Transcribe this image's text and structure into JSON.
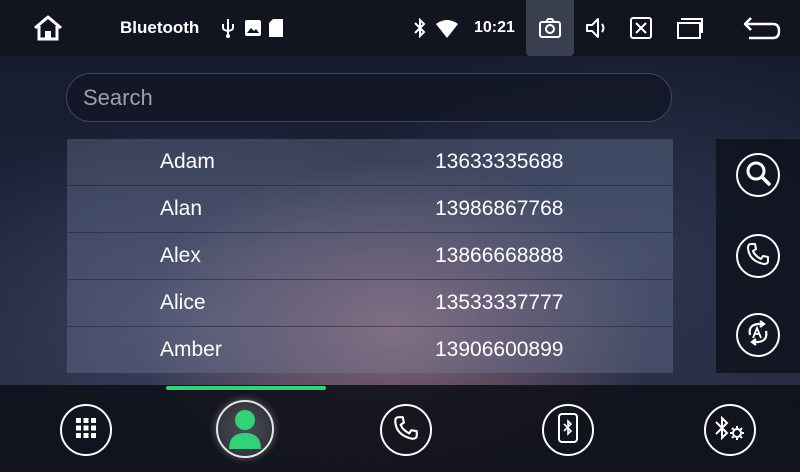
{
  "status_bar": {
    "home_icon": "home-icon",
    "title": "Bluetooth",
    "usb_icon": "usb-icon",
    "image_icon": "image-icon",
    "sd_card_icon": "sd-card-icon",
    "bluetooth_icon": "bluetooth-icon",
    "wifi_icon": "wifi-icon",
    "time": "10:21",
    "camera_icon": "camera-icon",
    "volume_icon": "volume-icon",
    "close_icon": "close-box-icon",
    "multitask_icon": "recent-apps-icon",
    "back_icon": "back-icon"
  },
  "search": {
    "placeholder": "Search",
    "value": ""
  },
  "contacts": [
    {
      "name": "Adam",
      "number": "13633335688"
    },
    {
      "name": "Alan",
      "number": "13986867768"
    },
    {
      "name": "Alex",
      "number": "13866668888"
    },
    {
      "name": "Alice",
      "number": "13533337777"
    },
    {
      "name": "Amber",
      "number": "13906600899"
    }
  ],
  "side_actions": [
    "search-icon",
    "phone-icon",
    "sync-icon"
  ],
  "bottom_nav": {
    "items": [
      "dialpad-icon",
      "contacts-icon",
      "call-log-icon",
      "phone-bluetooth-icon",
      "bluetooth-settings-icon"
    ],
    "active_index": 1
  },
  "colors": {
    "accent": "#33d17a",
    "status_bar_bg": "#12151f",
    "list_bg": "#6c7896"
  }
}
